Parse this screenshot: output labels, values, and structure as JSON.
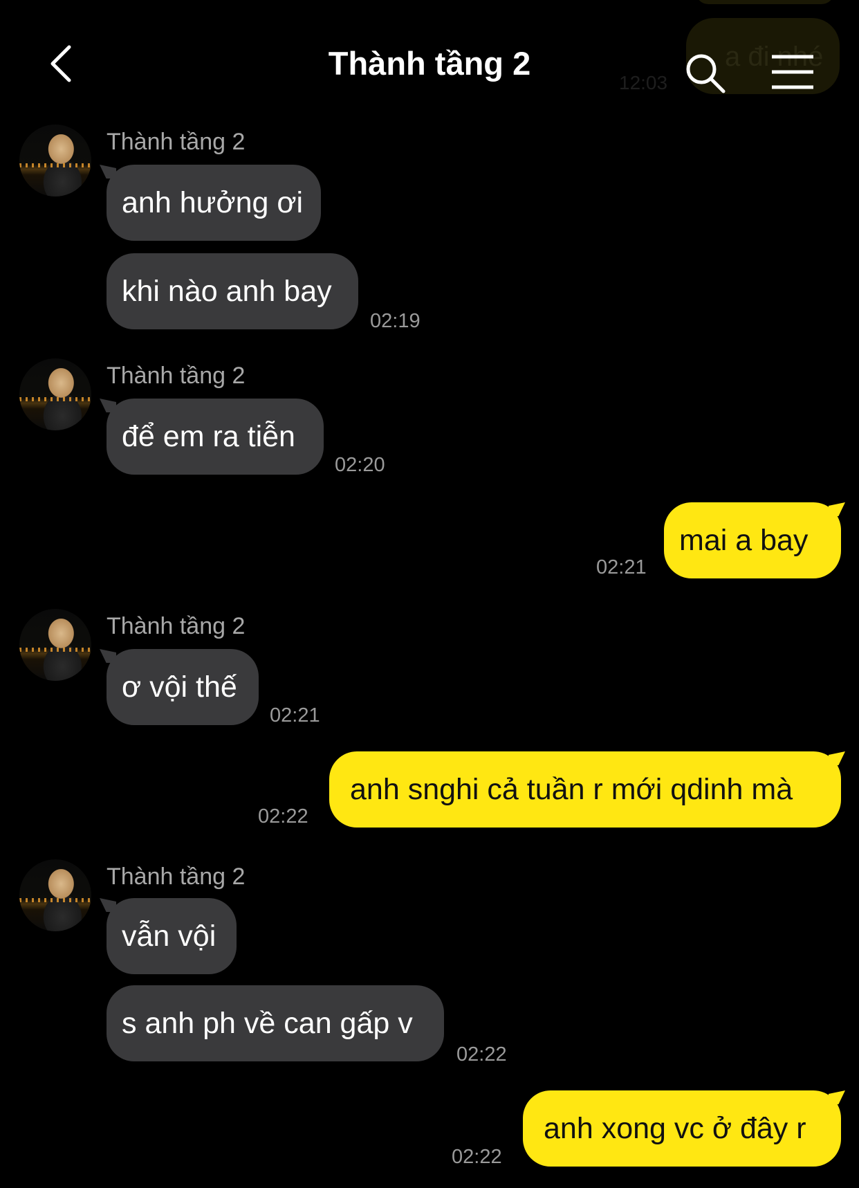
{
  "header": {
    "title": "Thành tầng 2",
    "back_icon": "chevron-left-icon",
    "search_icon": "search-icon",
    "menu_icon": "menu-icon"
  },
  "ghost": {
    "text": "a đi nhé",
    "time": "12:03"
  },
  "messages": [
    {
      "sender": "Thành tầng 2",
      "bubbles": [
        "anh hưởng ơi",
        "khi nào anh bay"
      ],
      "time": "02:19"
    },
    {
      "sender": "Thành tầng 2",
      "bubbles": [
        "để em ra tiễn"
      ],
      "time": "02:20"
    },
    {
      "out": "mai a bay",
      "time": "02:21"
    },
    {
      "sender": "Thành tầng 2",
      "bubbles": [
        "ơ vội thế"
      ],
      "time": "02:21"
    },
    {
      "out": "anh snghi cả tuần r mới qdinh mà",
      "time": "02:22"
    },
    {
      "sender": "Thành tầng 2",
      "bubbles": [
        "vẫn vội",
        "s anh ph về can gấp v"
      ],
      "time": "02:22"
    },
    {
      "out": "anh xong vc ở đây r",
      "time": "02:22"
    }
  ],
  "colors": {
    "background": "#000000",
    "incoming_bubble": "#3a3a3c",
    "outgoing_bubble": "#ffe712",
    "timestamp": "#9a9a9a"
  }
}
